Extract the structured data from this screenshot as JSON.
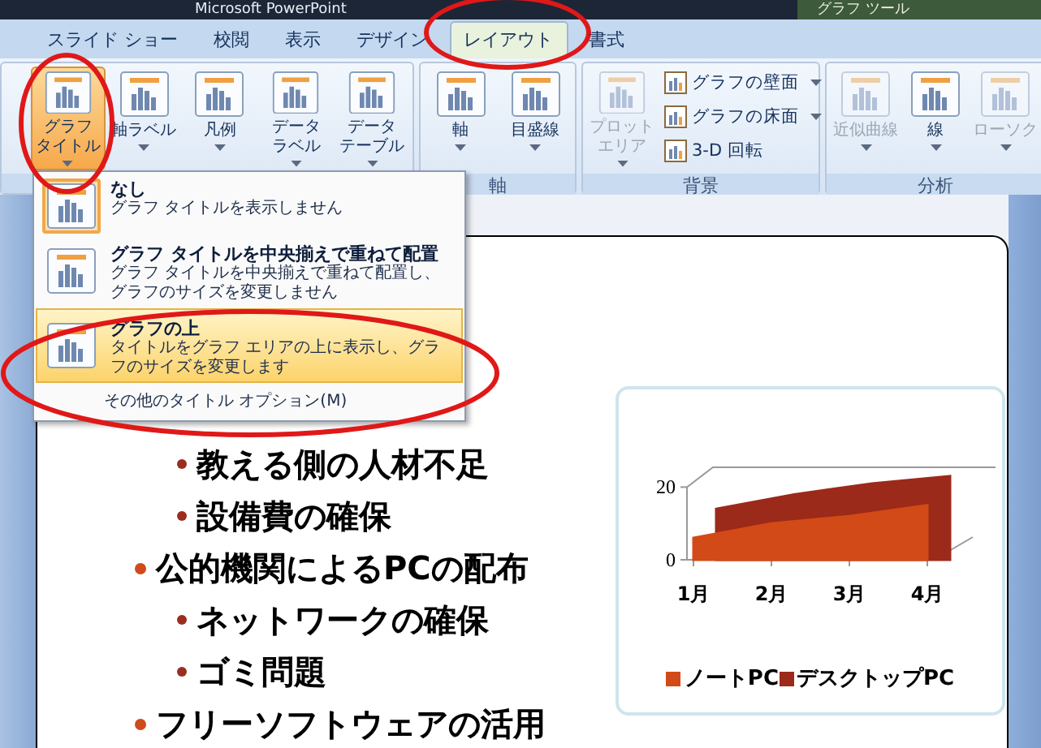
{
  "window": {
    "title": "Microsoft PowerPoint",
    "context_tab": "グラフ ツール"
  },
  "tabs": [
    {
      "label": "スライド ショー",
      "selected": false
    },
    {
      "label": "校閲",
      "selected": false
    },
    {
      "label": "表示",
      "selected": false
    },
    {
      "label": "デザイン",
      "selected": false
    },
    {
      "label": "レイアウト",
      "selected": true
    },
    {
      "label": "書式",
      "selected": false
    }
  ],
  "ribbon": {
    "groups": [
      {
        "buttons": [
          {
            "kind": "large",
            "lines": [
              "グラフ",
              "タイトル"
            ],
            "dropdown": true,
            "pressed": true,
            "disabled": false
          },
          {
            "kind": "large",
            "lines": [
              "軸ラベル"
            ],
            "dropdown": true,
            "pressed": false,
            "disabled": false
          },
          {
            "kind": "large",
            "lines": [
              "凡例"
            ],
            "dropdown": true,
            "pressed": false,
            "disabled": false
          },
          {
            "kind": "large",
            "lines": [
              "データ",
              "ラベル"
            ],
            "dropdown": true,
            "pressed": false,
            "disabled": false
          },
          {
            "kind": "large",
            "lines": [
              "データ",
              "テーブル"
            ],
            "dropdown": true,
            "pressed": false,
            "disabled": false
          }
        ]
      },
      {
        "label": "軸",
        "buttons": [
          {
            "kind": "large",
            "lines": [
              "軸"
            ],
            "dropdown": true,
            "pressed": false,
            "disabled": false
          },
          {
            "kind": "large",
            "lines": [
              "目盛線"
            ],
            "dropdown": true,
            "pressed": false,
            "disabled": false
          }
        ]
      },
      {
        "label": "背景",
        "buttons": [
          {
            "kind": "large",
            "lines": [
              "プロット",
              "エリア"
            ],
            "dropdown": true,
            "pressed": false,
            "disabled": true
          },
          {
            "kind": "small",
            "lines": [
              "グラフの壁面"
            ],
            "dropdown": true,
            "pressed": false,
            "disabled": false
          },
          {
            "kind": "small",
            "lines": [
              "グラフの床面"
            ],
            "dropdown": true,
            "pressed": false,
            "disabled": false
          },
          {
            "kind": "small",
            "lines": [
              "3-D 回転"
            ],
            "dropdown": false,
            "pressed": false,
            "disabled": false
          }
        ]
      },
      {
        "label": "分析",
        "buttons": [
          {
            "kind": "large",
            "lines": [
              "近似曲線"
            ],
            "dropdown": true,
            "pressed": false,
            "disabled": true
          },
          {
            "kind": "large",
            "lines": [
              "線"
            ],
            "dropdown": true,
            "pressed": false,
            "disabled": false
          },
          {
            "kind": "large",
            "lines": [
              "ローソク"
            ],
            "dropdown": true,
            "pressed": false,
            "disabled": true
          }
        ]
      }
    ]
  },
  "menu": {
    "items": [
      {
        "title": "なし",
        "description": "グラフ タイトルを表示しません",
        "checked": true,
        "selected": false
      },
      {
        "title": "グラフ タイトルを中央揃えで重ねて配置",
        "description": "グラフ タイトルを中央揃えで重ねて配置し、グラフのサイズを変更しません",
        "checked": false,
        "selected": false
      },
      {
        "title": "グラフの上",
        "description": "タイトルをグラフ エリアの上に表示し、グラフのサイズを変更します",
        "checked": false,
        "selected": true
      }
    ],
    "footer": "その他のタイトル オプション(M)"
  },
  "slide": {
    "bullets": [
      {
        "children": [
          {
            "text": "教える側の人材不足"
          },
          {
            "text": "設備費の確保"
          }
        ]
      },
      {
        "text": "公的機関によるPCの配布",
        "children": [
          {
            "text": "ネットワークの確保"
          },
          {
            "text": "ゴミ問題"
          }
        ]
      },
      {
        "text": "フリーソフトウェアの活用"
      }
    ],
    "chart_data": {
      "type": "area",
      "legend": "bottom",
      "categories": [
        "1月",
        "2月",
        "3月",
        "4月"
      ],
      "series": [
        {
          "name": "ノートPC",
          "color": "#d24a17",
          "values": [
            6,
            10,
            12,
            15
          ]
        },
        {
          "name": "デスクトップPC",
          "color": "#9c2a1a",
          "values": [
            14,
            18,
            21,
            23
          ]
        }
      ],
      "ylim": [
        0,
        25
      ],
      "yticks": [
        0,
        20
      ]
    }
  }
}
